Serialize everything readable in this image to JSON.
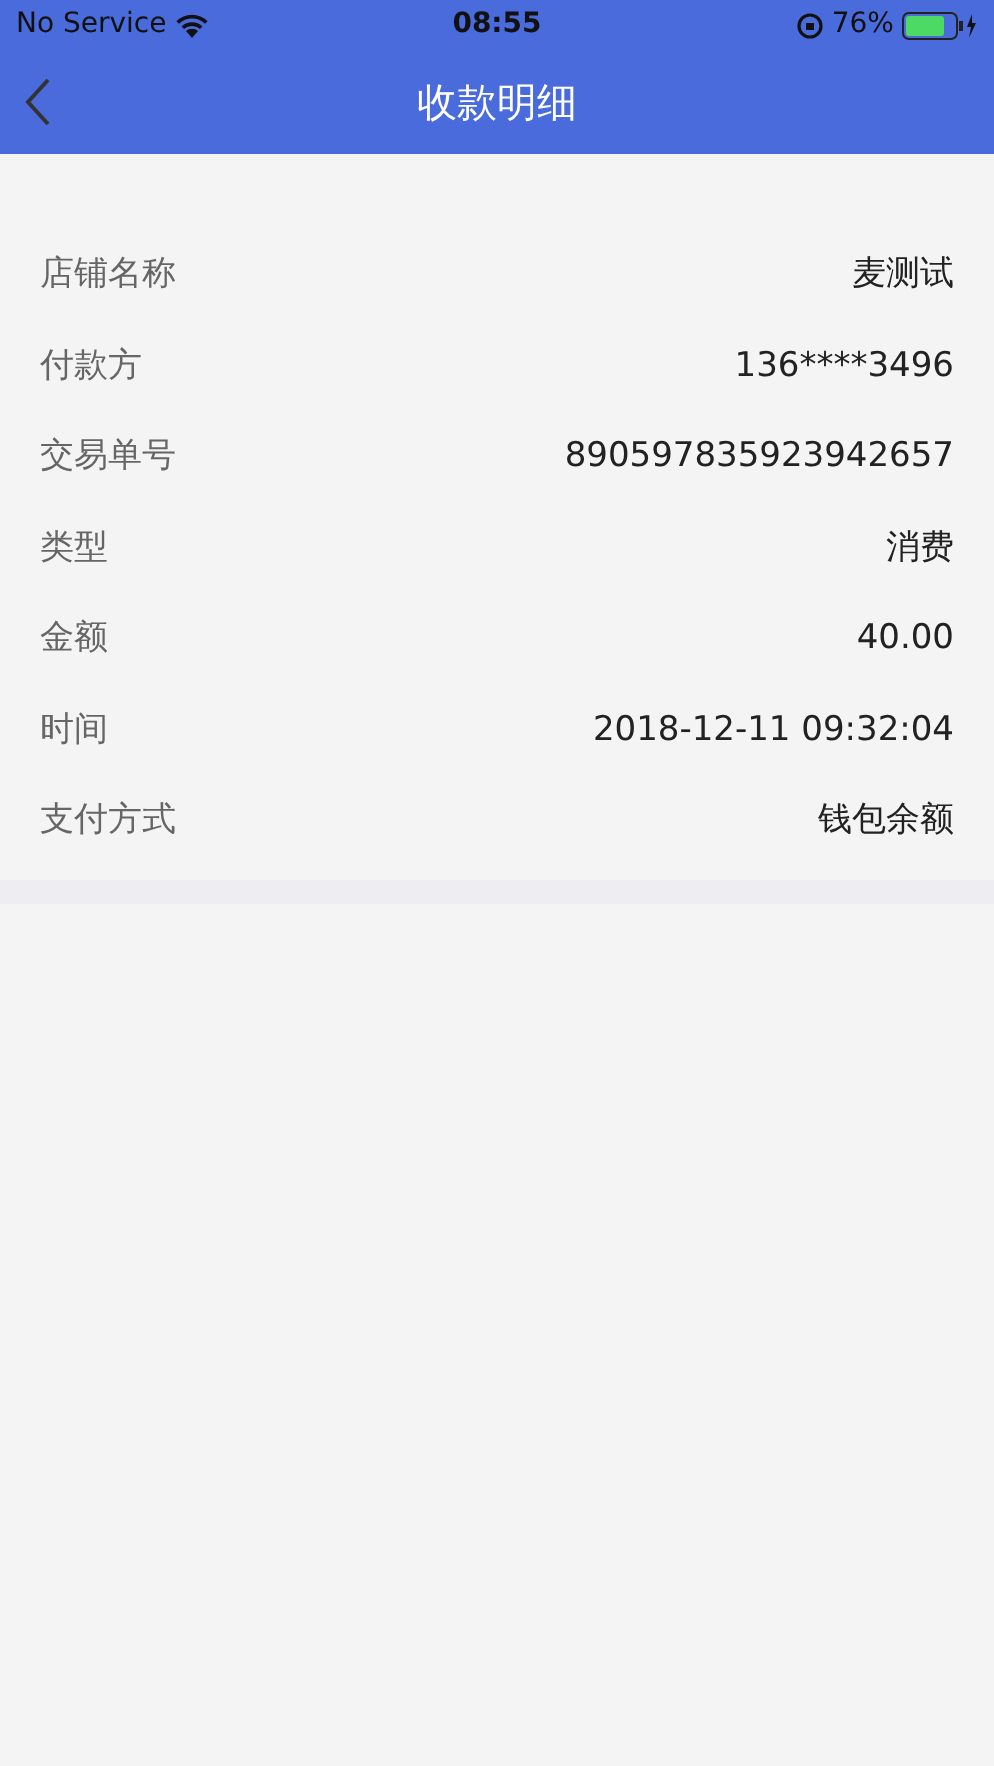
{
  "status_bar": {
    "carrier": "No Service",
    "time": "08:55",
    "battery": "76%"
  },
  "nav": {
    "title": "收款明细"
  },
  "details": [
    {
      "label": "店铺名称",
      "value": "麦测试"
    },
    {
      "label": "付款方",
      "value": "136****3496"
    },
    {
      "label": "交易单号",
      "value": "890597835923942657"
    },
    {
      "label": "类型",
      "value": "消费"
    },
    {
      "label": "金额",
      "value": "40.00"
    },
    {
      "label": "时间",
      "value": "2018-12-11 09:32:04"
    },
    {
      "label": "支付方式",
      "value": "钱包余额"
    }
  ]
}
